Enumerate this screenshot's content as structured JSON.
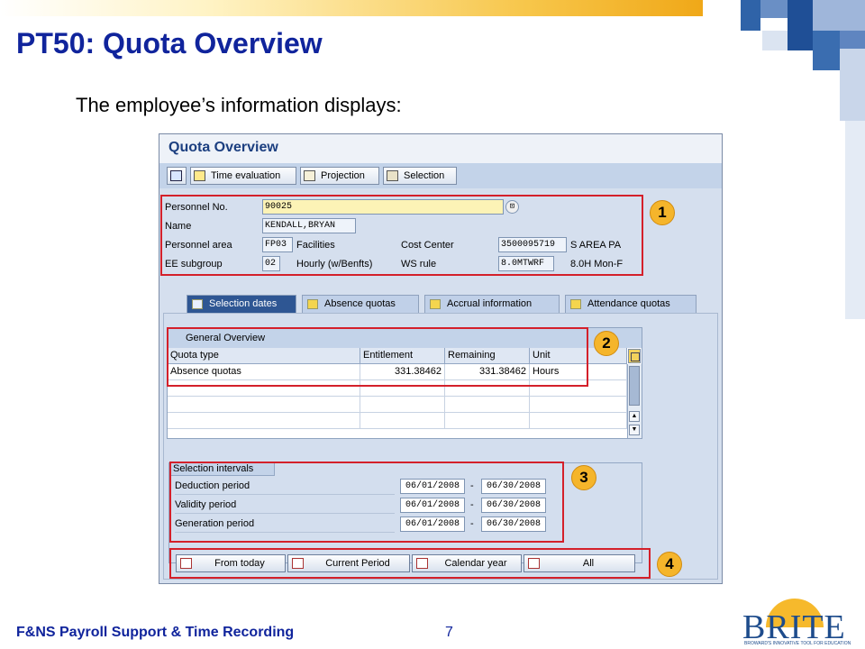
{
  "slide": {
    "title": "PT50: Quota Overview",
    "subtitle": "The employee’s information displays:",
    "footer": "F&NS Payroll Support & Time Recording",
    "page_number": "7",
    "logo_text": "BRITE",
    "logo_tagline": "BROWARD'S INNOVATIVE TOOL FOR EDUCATION"
  },
  "sap": {
    "window_title": "Quota Overview",
    "toolbar": [
      {
        "label": "Time evaluation",
        "icon": "time-evaluation-icon"
      },
      {
        "label": "Projection",
        "icon": "projection-icon"
      },
      {
        "label": "Selection",
        "icon": "selection-icon"
      }
    ],
    "header": {
      "personnel_no_label": "Personnel No.",
      "personnel_no": "90025",
      "name_label": "Name",
      "name": "KENDALL,BRYAN",
      "personnel_area_label": "Personnel area",
      "personnel_area": "FP03",
      "personnel_area_text": "Facilities",
      "cost_center_label": "Cost Center",
      "cost_center": "3500095719",
      "cost_center_text": "S AREA PA",
      "ee_subgroup_label": "EE subgroup",
      "ee_subgroup": "02",
      "ee_subgroup_text": "Hourly (w/Benfts)",
      "ws_rule_label": "WS rule",
      "ws_rule": "8.0MTWRF",
      "ws_rule_text": "8.0H Mon-F"
    },
    "tabs": [
      {
        "label": "Selection dates",
        "active": true
      },
      {
        "label": "Absence quotas",
        "active": false
      },
      {
        "label": "Accrual information",
        "active": false
      },
      {
        "label": "Attendance quotas",
        "active": false
      }
    ],
    "overview": {
      "title": "General Overview",
      "columns": [
        "Quota type",
        "Entitlement",
        "Remaining",
        "Unit"
      ],
      "rows": [
        [
          "Absence quotas",
          "331.38462",
          "331.38462",
          "Hours"
        ]
      ]
    },
    "intervals": {
      "title": "Selection intervals",
      "rows": [
        {
          "label": "Deduction period",
          "from": "06/01/2008",
          "to": "06/30/2008"
        },
        {
          "label": "Validity period",
          "from": "06/01/2008",
          "to": "06/30/2008"
        },
        {
          "label": "Generation period",
          "from": "06/01/2008",
          "to": "06/30/2008"
        }
      ],
      "separator": "-"
    },
    "period_buttons": [
      "From today",
      "Current Period",
      "Calendar year",
      "All"
    ]
  },
  "callouts": [
    "1",
    "2",
    "3",
    "4"
  ],
  "colors": {
    "title_blue": "#10249c",
    "callout_orange": "#f5b52b",
    "highlight_red": "#d4202a",
    "sap_tab_active": "#2e5693"
  }
}
